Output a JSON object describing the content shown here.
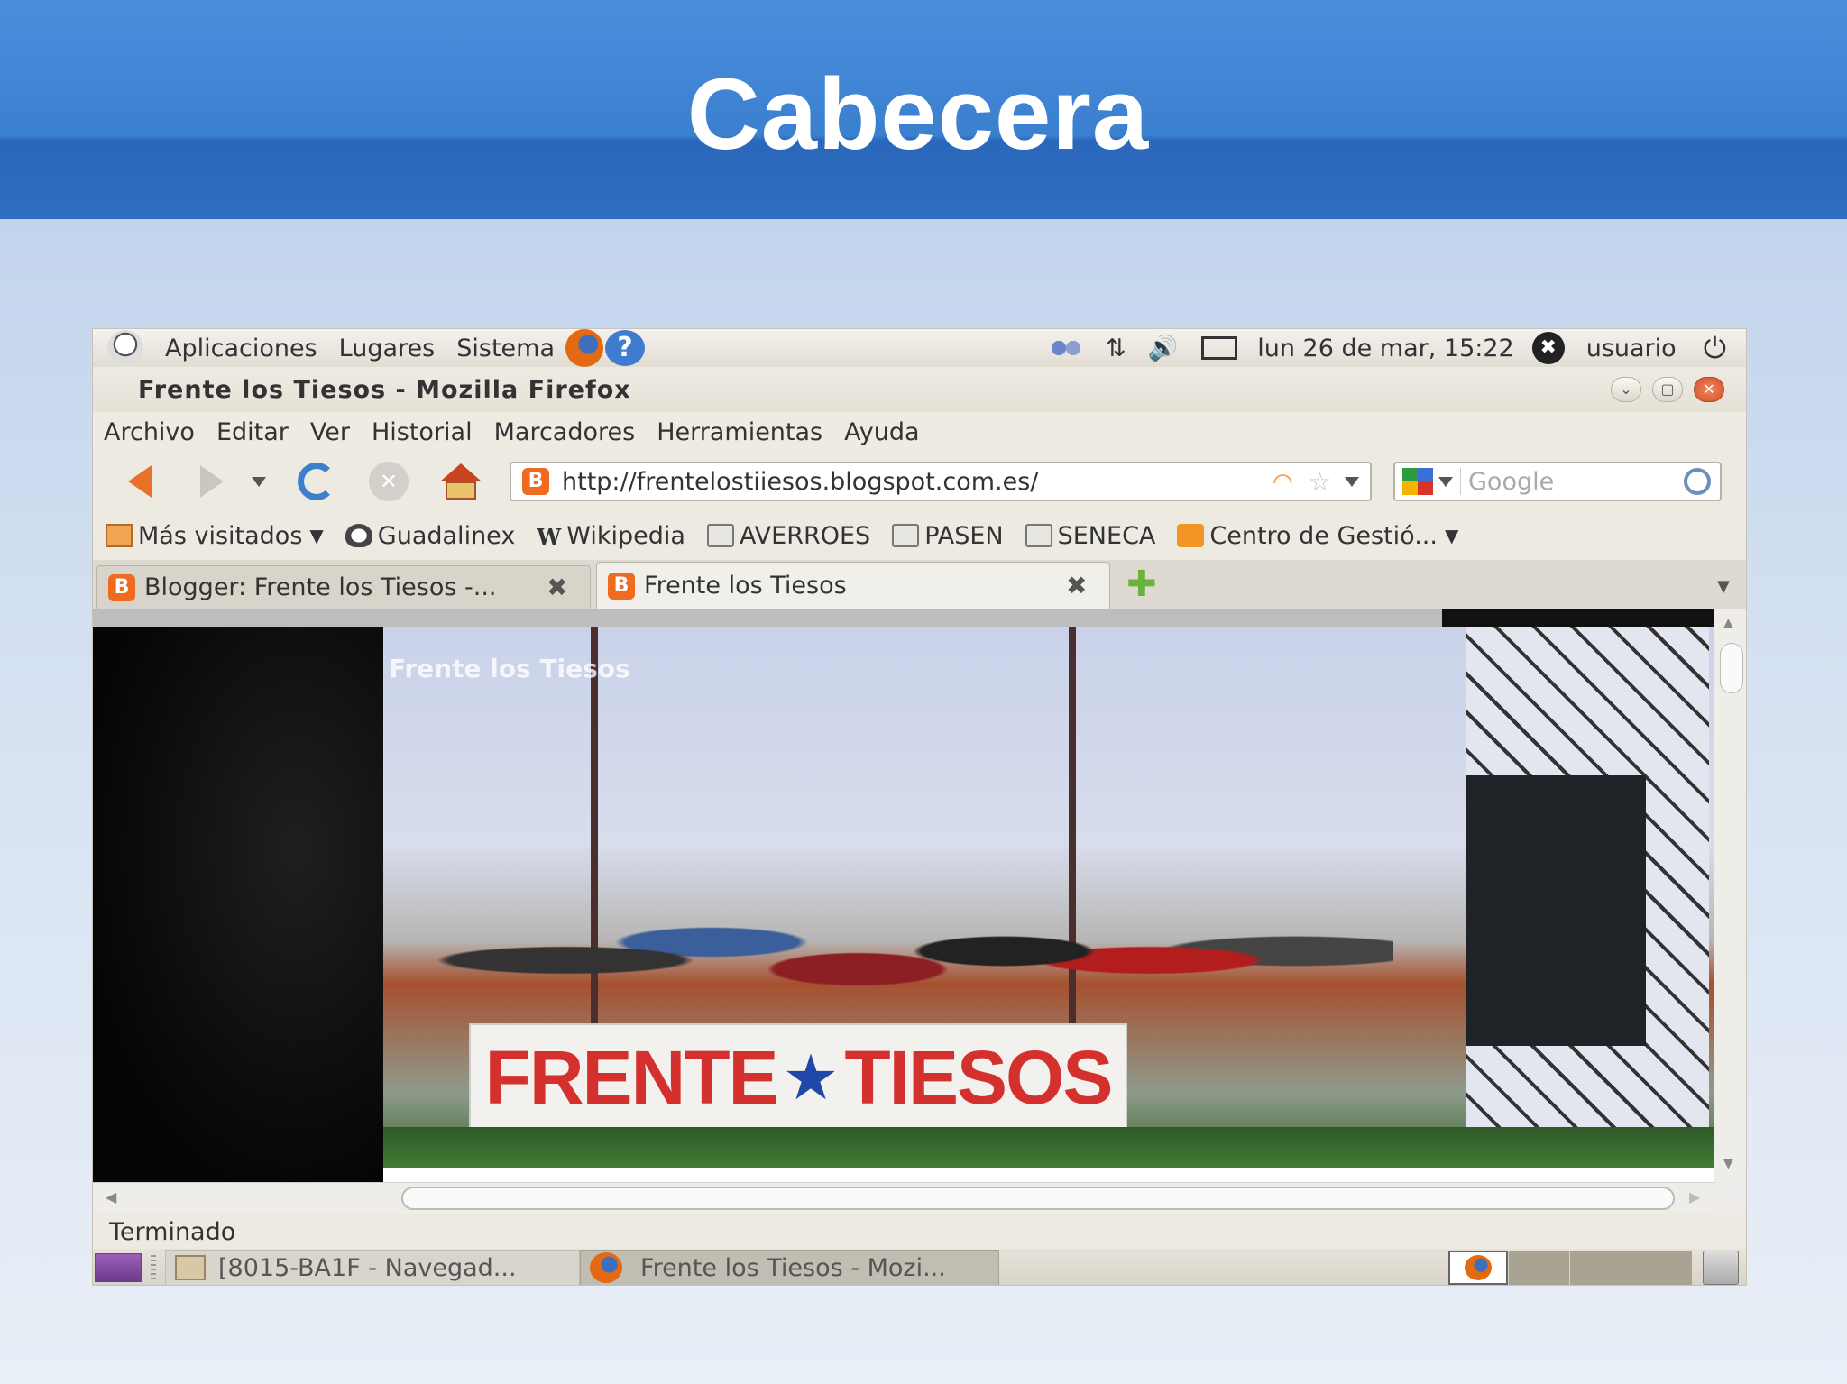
{
  "slide": {
    "title": "Cabecera"
  },
  "top_panel": {
    "menus": [
      "Aplicaciones",
      "Lugares",
      "Sistema"
    ],
    "help_glyph": "?",
    "clock": "lun 26 de mar, 15:22",
    "user": "usuario",
    "icons": [
      "gnome-foot-icon",
      "firefox-icon",
      "help-icon",
      "users-icon",
      "network-icon",
      "volume-icon",
      "mail-icon",
      "user-status-icon",
      "power-icon"
    ]
  },
  "window": {
    "title": "Frente los Tiesos - Mozilla Firefox"
  },
  "menubar": [
    "Archivo",
    "Editar",
    "Ver",
    "Historial",
    "Marcadores",
    "Herramientas",
    "Ayuda"
  ],
  "navigation": {
    "url": "http://frentelostiiesos.blogspot.com.es/",
    "search_placeholder": "Google"
  },
  "bookmarks": [
    {
      "label": "Más visitados",
      "icon": "folder-icon",
      "dropdown": true
    },
    {
      "label": "Guadalinex",
      "icon": "penguin-icon",
      "dropdown": false
    },
    {
      "label": "Wikipedia",
      "icon": "wikipedia-icon",
      "dropdown": false
    },
    {
      "label": "AVERROES",
      "icon": "page-icon",
      "dropdown": false
    },
    {
      "label": "PASEN",
      "icon": "page-icon",
      "dropdown": false
    },
    {
      "label": "SENECA",
      "icon": "page-icon",
      "dropdown": false
    },
    {
      "label": "Centro de Gestió...",
      "icon": "rss-icon",
      "dropdown": true
    }
  ],
  "tabs": [
    {
      "label": "Blogger: Frente los Tiesos -...",
      "active": false
    },
    {
      "label": "Frente los Tiesos",
      "active": true
    }
  ],
  "page": {
    "blog_title": "Frente los Tiesos",
    "banner_text_left": "FRENTE",
    "banner_text_right": "TIESOS"
  },
  "status": "Terminado",
  "taskbar": [
    {
      "label": "[8015-BA1F - Navegad...",
      "icon": "folder-icon"
    },
    {
      "label": "Frente los Tiesos - Mozi...",
      "icon": "firefox-icon"
    }
  ],
  "colors": {
    "slide_header": "#3b7fcf",
    "accent_orange": "#f06a20",
    "banner_red": "#d4312e",
    "banner_blue": "#1f48a8"
  }
}
